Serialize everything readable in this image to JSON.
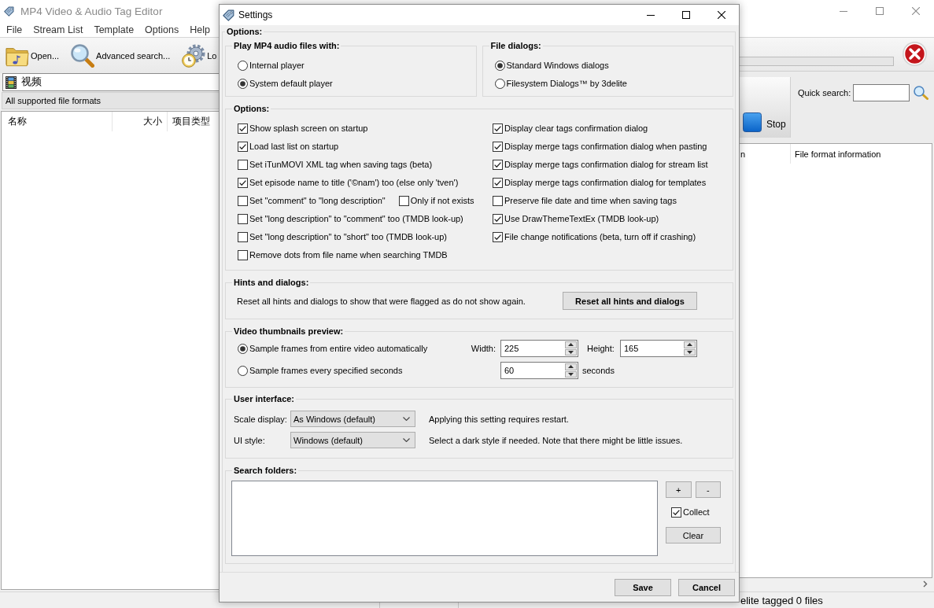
{
  "main_window": {
    "title": "MP4 Video & Audio Tag Editor",
    "menu": [
      "File",
      "Stream List",
      "Template",
      "Options",
      "Help"
    ],
    "toolbar": [
      {
        "kind": "open",
        "label": "Open..."
      },
      {
        "kind": "search",
        "label": "Advanced search..."
      },
      {
        "kind": "load",
        "label": "Lo"
      }
    ],
    "folder": "视频",
    "filter": "All supported file formats",
    "file_columns": [
      "名称",
      "大小",
      "项目类型"
    ],
    "progress": {
      "level": 0
    },
    "stop_button": "Stop",
    "quick_search_label": "Quick search:",
    "info_columns": [
      "n",
      "File format information"
    ],
    "status_bar": "elite tagged 0 files"
  },
  "settings": {
    "title": "Settings",
    "caption": "Options:",
    "player": {
      "title": "Play MP4 audio files with:",
      "options": [
        {
          "label": "Internal player",
          "selected": false
        },
        {
          "label": "System default player",
          "selected": true
        }
      ]
    },
    "file_dialogs": {
      "title": "File dialogs:",
      "options": [
        {
          "label": "Standard Windows dialogs",
          "selected": true
        },
        {
          "label": "Filesystem Dialogs™ by 3delite",
          "selected": false
        }
      ]
    },
    "options": {
      "title": "Options:",
      "left": [
        {
          "label": "Show splash screen on startup",
          "checked": true
        },
        {
          "label": "Load last list on startup",
          "checked": true
        },
        {
          "label": "Set iTunMOVI XML tag when saving tags (beta)",
          "checked": false
        },
        {
          "label": "Set episode name to title ('©nam') too (else only 'tven')",
          "checked": true
        },
        {
          "label": "Set \"comment\" to \"long description\"",
          "checked": false,
          "extra": {
            "label": "Only if not exists",
            "checked": false
          }
        },
        {
          "label": "Set \"long description\" to \"comment\" too (TMDB look-up)",
          "checked": false
        },
        {
          "label": "Set \"long description\" to \"short\" too (TMDB look-up)",
          "checked": false
        },
        {
          "label": "Remove dots from file name when searching TMDB",
          "checked": false
        }
      ],
      "right": [
        {
          "label": "Display clear tags confirmation dialog",
          "checked": true
        },
        {
          "label": "Display merge tags confirmation dialog when pasting",
          "checked": true
        },
        {
          "label": "Display merge tags confirmation dialog for stream list",
          "checked": true
        },
        {
          "label": "Display merge tags confirmation dialog for templates",
          "checked": true
        },
        {
          "label": "Preserve file date and time when saving tags",
          "checked": false
        },
        {
          "label": "Use DrawThemeTextEx (TMDB look-up)",
          "checked": true
        },
        {
          "label": "File change notifications (beta, turn off if crashing)",
          "checked": true
        }
      ]
    },
    "hints": {
      "title": "Hints and dialogs:",
      "text": "Reset all hints and dialogs to show that were flagged as do not show again.",
      "button": "Reset all hints and dialogs"
    },
    "thumbnails": {
      "title": "Video thumbnails preview:",
      "modes": [
        {
          "label": "Sample frames from entire video automatically",
          "selected": true
        },
        {
          "label": "Sample frames every specified seconds",
          "selected": false
        }
      ],
      "width": {
        "label": "Width:",
        "value": "225"
      },
      "height": {
        "label": "Height:",
        "value": "165"
      },
      "interval": {
        "value": "60",
        "unit": "seconds"
      }
    },
    "user_interface": {
      "title": "User interface:",
      "rows": [
        {
          "label": "Scale display:",
          "value": "As Windows (default)",
          "note": "Applying this setting requires restart."
        },
        {
          "label": "UI style:",
          "value": "Windows (default)",
          "note": "Select a dark style if needed. Note that there might be little issues."
        }
      ]
    },
    "search_folders": {
      "title": "Search folders:",
      "add_button": "+",
      "remove_button": "-",
      "collect": {
        "label": "Collect",
        "checked": true
      },
      "clear_button": "Clear"
    },
    "buttons": [
      "Save",
      "Cancel"
    ]
  }
}
